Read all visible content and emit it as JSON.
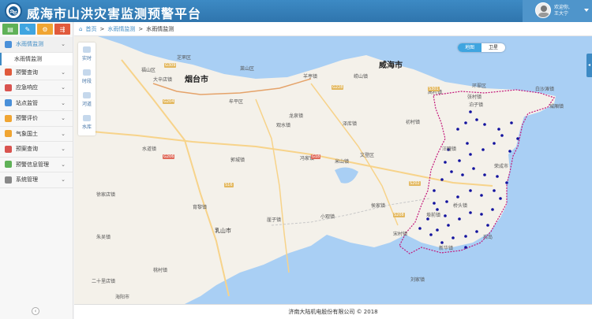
{
  "header": {
    "title": "威海市山洪灾害监测预警平台",
    "welcome_line1": "欢迎你,",
    "welcome_line2": "王大宁"
  },
  "sidebar": {
    "shortcut_colors": [
      "#5fb157",
      "#3fa5e0",
      "#f0a532",
      "#e05a3c"
    ],
    "shortcut_icons": [
      "chart-icon",
      "pencil-icon",
      "gear-icon",
      "share-icon"
    ],
    "items": [
      {
        "label": "水雨情监测",
        "expanded": true,
        "icon_color": "#4a90d9"
      },
      {
        "label": "预警查询",
        "icon_color": "#e05a3c"
      },
      {
        "label": "应急响应",
        "icon_color": "#d9534f"
      },
      {
        "label": "站点监管",
        "icon_color": "#4a90d9"
      },
      {
        "label": "预警评价",
        "icon_color": "#f0a532"
      },
      {
        "label": "气象国土",
        "icon_color": "#f0a532"
      },
      {
        "label": "预案查询",
        "icon_color": "#d9534f"
      },
      {
        "label": "预警信息管理",
        "icon_color": "#5fb157"
      },
      {
        "label": "系统管理",
        "icon_color": "#888888"
      }
    ],
    "active_sub_item": "水雨情监测"
  },
  "breadcrumb": {
    "home": "首页",
    "sep": ">",
    "level1": "水雨情监测",
    "level2": "水雨情监测"
  },
  "map": {
    "switch": {
      "map": "地图",
      "satellite": "卫星"
    },
    "tools": [
      "实时",
      "时段",
      "河道",
      "水库"
    ],
    "cities": [
      "烟台市",
      "威海市",
      "乳山市"
    ],
    "places": [
      "芝罘区",
      "福山区",
      "莱山区",
      "牟平区",
      "龙泉镇",
      "观水镇",
      "水道镇",
      "郭城镇",
      "冯家镇",
      "崖子镇",
      "育黎镇",
      "朱吴镇",
      "二十里店镇",
      "海阳市",
      "桃村镇",
      "文登区",
      "米山镇",
      "侯家镇",
      "宋村镇",
      "小观镇",
      "泽库镇",
      "汪疃镇",
      "荣成市",
      "石岛",
      "环翠区",
      "张村镇",
      "桥头镇",
      "埠前镇",
      "高村镇",
      "崂山镇",
      "徐家店镇",
      "大辛店镇",
      "羊亭镇",
      "初村镇",
      "泊子镇",
      "白沙滩镇",
      "城厢镇",
      "新华镇",
      "刘家镇"
    ],
    "roads": [
      "G18",
      "G206",
      "S16",
      "G204",
      "G309",
      "S202",
      "S208",
      "G228",
      "S301"
    ],
    "accent": "#3fa5e0",
    "boundary_color": "#c3187a",
    "station_color": "#12129e"
  },
  "footer": {
    "copyright": "济南大陆机电股份有限公司 © 2018"
  }
}
